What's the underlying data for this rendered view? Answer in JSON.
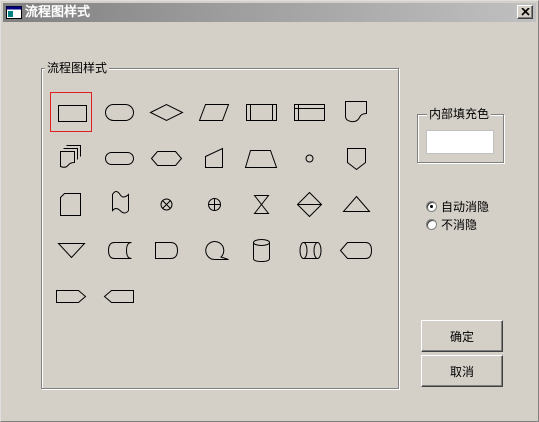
{
  "window": {
    "title": "流程图样式"
  },
  "shapes_group": {
    "label": "流程图样式"
  },
  "shapes": [
    {
      "name": "process-rectangle",
      "selected": true
    },
    {
      "name": "terminator-rounded"
    },
    {
      "name": "decision-diamond"
    },
    {
      "name": "data-parallelogram"
    },
    {
      "name": "predefined-process"
    },
    {
      "name": "internal-storage"
    },
    {
      "name": "document"
    },
    {
      "name": "multi-document"
    },
    {
      "name": "alternate-process"
    },
    {
      "name": "preparation-hexagon"
    },
    {
      "name": "manual-input"
    },
    {
      "name": "manual-operation"
    },
    {
      "name": "connector"
    },
    {
      "name": "off-page-connector"
    },
    {
      "name": "card"
    },
    {
      "name": "punched-tape"
    },
    {
      "name": "summing-junction"
    },
    {
      "name": "or"
    },
    {
      "name": "collate"
    },
    {
      "name": "sort"
    },
    {
      "name": "extract"
    },
    {
      "name": "merge"
    },
    {
      "name": "stored-data"
    },
    {
      "name": "delay"
    },
    {
      "name": "sequential-access-storage"
    },
    {
      "name": "magnetic-disk"
    },
    {
      "name": "direct-access-storage"
    },
    {
      "name": "display"
    },
    {
      "name": "pentagon-arrow"
    },
    {
      "name": "pentagon-arrow-left"
    }
  ],
  "fill_group": {
    "label": "内部填充色",
    "color": "#ffffff"
  },
  "radios": [
    {
      "label": "自动消隐",
      "checked": true
    },
    {
      "label": "不消隐",
      "checked": false
    }
  ],
  "buttons": {
    "ok": "确定",
    "cancel": "取消"
  }
}
